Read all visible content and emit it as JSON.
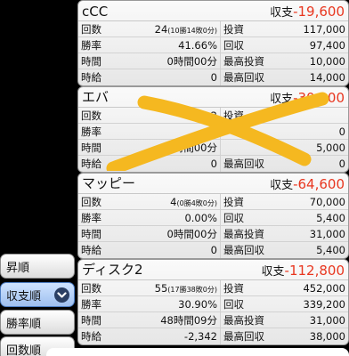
{
  "cards": [
    {
      "title": "cCC",
      "balance_label": "収支",
      "balance_value": "-19,600",
      "rows": [
        {
          "l_label": "回数",
          "l_value": "24",
          "l_note": "(10勝14敗0分)",
          "r_label": "投資",
          "r_value": "117,000"
        },
        {
          "l_label": "勝率",
          "l_value": "41.66%",
          "r_label": "回収",
          "r_value": "97,400"
        },
        {
          "l_label": "時間",
          "l_value": "0時間00分",
          "r_label": "最高投資",
          "r_value": "10,000"
        },
        {
          "l_label": "時給",
          "l_value": "0",
          "r_label": "最高回収",
          "r_value": "14,000"
        }
      ]
    },
    {
      "title": "エバ",
      "balance_label": "収支",
      "balance_value": "-30,000",
      "rows": [
        {
          "l_label": "回数",
          "l_value": "2",
          "l_note": "",
          "r_label": "投資",
          "r_value": ""
        },
        {
          "l_label": "勝率",
          "l_value": "",
          "r_label": "",
          "r_value": "0"
        },
        {
          "l_label": "時間",
          "l_value": "0時間00分",
          "r_label": "",
          "r_value": "5,000"
        },
        {
          "l_label": "時給",
          "l_value": "0",
          "r_label": "最高回収",
          "r_value": "0"
        }
      ]
    },
    {
      "title": "マッピー",
      "balance_label": "収支",
      "balance_value": "-64,600",
      "rows": [
        {
          "l_label": "回数",
          "l_value": "4",
          "l_note": "(0勝4敗0分)",
          "r_label": "投資",
          "r_value": "70,000"
        },
        {
          "l_label": "勝率",
          "l_value": "0.00%",
          "r_label": "回収",
          "r_value": "5,400"
        },
        {
          "l_label": "時間",
          "l_value": "0時間00分",
          "r_label": "最高投資",
          "r_value": "31,000"
        },
        {
          "l_label": "時給",
          "l_value": "0",
          "r_label": "最高回収",
          "r_value": "5,400"
        }
      ]
    },
    {
      "title": "ディスク2",
      "balance_label": "収支",
      "balance_value": "-112,800",
      "rows": [
        {
          "l_label": "回数",
          "l_value": "55",
          "l_note": "(17勝38敗0分)",
          "r_label": "投資",
          "r_value": "452,000"
        },
        {
          "l_label": "勝率",
          "l_value": "30.90%",
          "r_label": "回収",
          "r_value": "339,200"
        },
        {
          "l_label": "時間",
          "l_value": "48時間09分",
          "r_label": "最高投資",
          "r_value": "31,000"
        },
        {
          "l_label": "時給",
          "l_value": "-2,342",
          "r_label": "最高回収",
          "r_value": "38,000"
        }
      ]
    }
  ],
  "sort_buttons": [
    {
      "label": "昇順",
      "selected": false
    },
    {
      "label": "収支順",
      "selected": true
    },
    {
      "label": "勝率順",
      "selected": false
    },
    {
      "label": "回数順",
      "selected": false
    }
  ],
  "icons": {
    "selected_indicator": "chevron-down-icon"
  },
  "colors": {
    "negative": "#e8361f",
    "scribble": "#f5b820",
    "selected_sort": "#9fc0ef"
  }
}
